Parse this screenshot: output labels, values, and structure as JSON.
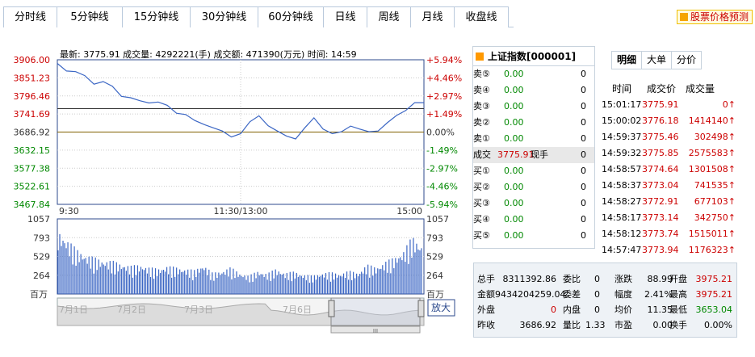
{
  "tabs": [
    "分时线",
    "5分钟线",
    "15分钟线",
    "30分钟线",
    "60分钟线",
    "日线",
    "周线",
    "月线",
    "收盘线"
  ],
  "forecast_label": "股票价格预测",
  "topline": "最新: 3775.91 成交量: 4292221(手) 成交额: 471390(万元) 时间: 14:59",
  "chart_data": {
    "type": "line",
    "price_ticks_left": [
      "3906.00",
      "3851.23",
      "3796.46",
      "3741.69",
      "3686.92",
      "3632.15",
      "3577.38",
      "3522.61",
      "3467.84"
    ],
    "pct_ticks_right": [
      "+5.94%",
      "+4.46%",
      "+2.97%",
      "+1.49%",
      "0.00%",
      "-1.49%",
      "-2.97%",
      "-4.46%",
      "-5.94%"
    ],
    "time_labels": [
      "9:30",
      "11:30/13:00",
      "15:00"
    ],
    "vol_ticks": [
      "1057",
      "793",
      "529",
      "264"
    ],
    "vol_unit": "百万",
    "ylim": [
      3467.84,
      3906.0
    ],
    "prev_close": 3686.92,
    "avg_level": 3758.0,
    "x": [
      0,
      6,
      12,
      18,
      24,
      30,
      36,
      42,
      48,
      54,
      60,
      66,
      72,
      78,
      84,
      90,
      96,
      102,
      108,
      114,
      120,
      126,
      132,
      138,
      144,
      150,
      156,
      162,
      168,
      174,
      180,
      186,
      192,
      198,
      204,
      210,
      216,
      222,
      228,
      234,
      240
    ],
    "price": [
      3895,
      3872,
      3870,
      3858,
      3832,
      3840,
      3826,
      3795,
      3791,
      3782,
      3775,
      3778,
      3768,
      3744,
      3740,
      3722,
      3710,
      3700,
      3690,
      3672,
      3682,
      3718,
      3736,
      3706,
      3690,
      3675,
      3666,
      3700,
      3730,
      3696,
      3682,
      3688,
      3705,
      3696,
      3688,
      3690,
      3715,
      3737,
      3752,
      3776,
      3776
    ],
    "volume": [
      900,
      780,
      640,
      560,
      520,
      480,
      470,
      430,
      400,
      420,
      380,
      360,
      400,
      380,
      360,
      340,
      420,
      300,
      330,
      380,
      300,
      260,
      330,
      290,
      360,
      300,
      320,
      280,
      260,
      300,
      310,
      290,
      330,
      300,
      420,
      380,
      460,
      520,
      610,
      820,
      700
    ],
    "date_labels": [
      "7月1日",
      "7月2日",
      "7月3日",
      "7月6日"
    ],
    "zoom_label": "放大"
  },
  "quote": {
    "title": "上证指数[000001]",
    "sells": [
      {
        "l": "卖⑤",
        "p": "0.00",
        "v": "0"
      },
      {
        "l": "卖④",
        "p": "0.00",
        "v": "0"
      },
      {
        "l": "卖③",
        "p": "0.00",
        "v": "0"
      },
      {
        "l": "卖②",
        "p": "0.00",
        "v": "0"
      },
      {
        "l": "卖①",
        "p": "0.00",
        "v": "0"
      }
    ],
    "deal": {
      "l": "成交",
      "p": "3775.91",
      "x": "现手",
      "v": "0"
    },
    "buys": [
      {
        "l": "买①",
        "p": "0.00",
        "v": "0"
      },
      {
        "l": "买②",
        "p": "0.00",
        "v": "0"
      },
      {
        "l": "买③",
        "p": "0.00",
        "v": "0"
      },
      {
        "l": "买④",
        "p": "0.00",
        "v": "0"
      },
      {
        "l": "买⑤",
        "p": "0.00",
        "v": "0"
      }
    ]
  },
  "detail": {
    "tabs": [
      "明细",
      "大单",
      "分价"
    ],
    "headers": [
      "时间",
      "成交价",
      "成交量"
    ],
    "rows": [
      {
        "t": "15:01:17",
        "p": "3775.91",
        "v": "0↑"
      },
      {
        "t": "15:00:02",
        "p": "3776.18",
        "v": "1414140↑"
      },
      {
        "t": "14:59:37",
        "p": "3775.46",
        "v": "302498↑"
      },
      {
        "t": "14:59:32",
        "p": "3775.85",
        "v": "2575583↑"
      },
      {
        "t": "14:58:57",
        "p": "3774.64",
        "v": "1301508↑"
      },
      {
        "t": "14:58:37",
        "p": "3773.04",
        "v": "741535↑"
      },
      {
        "t": "14:58:27",
        "p": "3772.91",
        "v": "677103↑"
      },
      {
        "t": "14:58:17",
        "p": "3773.14",
        "v": "342750↑"
      },
      {
        "t": "14:58:12",
        "p": "3773.74",
        "v": "1515011↑"
      },
      {
        "t": "14:57:47",
        "p": "3773.94",
        "v": "1176323↑"
      }
    ]
  },
  "summary": {
    "r1": [
      "总手",
      "8311392.86",
      "委比",
      "0",
      "涨跌",
      "88.99",
      "开盘",
      "3975.21"
    ],
    "r2": [
      "金额",
      "9434204259.04",
      "委差",
      "0",
      "幅度",
      "2.41%",
      "最高",
      "3975.21"
    ],
    "r3": [
      "外盘",
      "0",
      "内盘",
      "0",
      "均价",
      "11.35",
      "最低",
      "3653.04"
    ],
    "r4": [
      "昨收",
      "3686.92",
      "量比",
      "1.33",
      "市盈",
      "0.00",
      "换手",
      "0.00%"
    ]
  },
  "colors": {
    "line": "#3b66c4",
    "bar": "#3b66c4",
    "up": "#cc0000",
    "down": "#008800"
  }
}
